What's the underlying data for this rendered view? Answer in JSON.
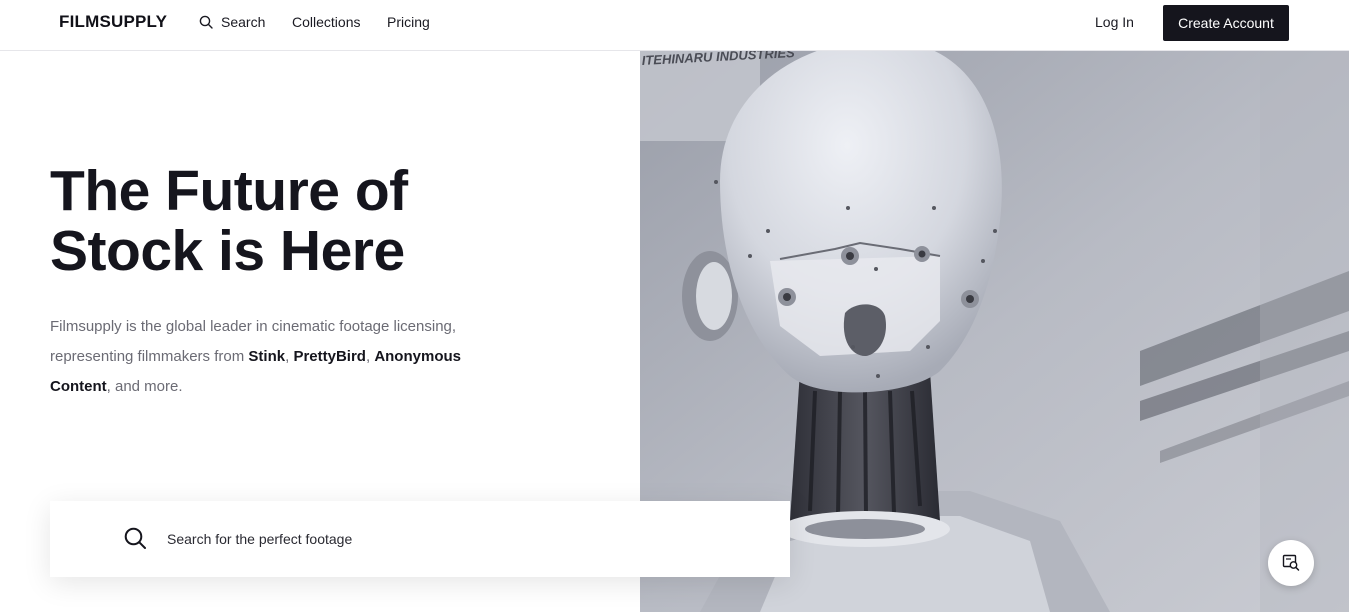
{
  "header": {
    "logo": "FILMSUPPLY",
    "search_label": "Search",
    "nav": [
      "Collections",
      "Pricing"
    ],
    "login_label": "Log In",
    "create_account_label": "Create Account"
  },
  "hero": {
    "title_line1": "The Future of",
    "title_line2": "Stock is Here",
    "description": {
      "part1": "Filmsupply is the global leader in cinematic footage licensing, representing filmmakers from ",
      "brand1": "Stink",
      "sep1": ", ",
      "brand2": "PrettyBird",
      "sep2": ", ",
      "brand3": "Anonymous Content",
      "part2": ", and more."
    },
    "image_caption": "ITEHINARU INDUSTRIES"
  },
  "search": {
    "placeholder": "Search for the perfect footage",
    "value": ""
  },
  "icons": {
    "nav_search": "search-icon",
    "big_search": "search-icon",
    "fab": "image-search-icon"
  },
  "colors": {
    "primary_dark": "#15151d",
    "text_muted": "#6b6b74",
    "background": "#ffffff"
  }
}
